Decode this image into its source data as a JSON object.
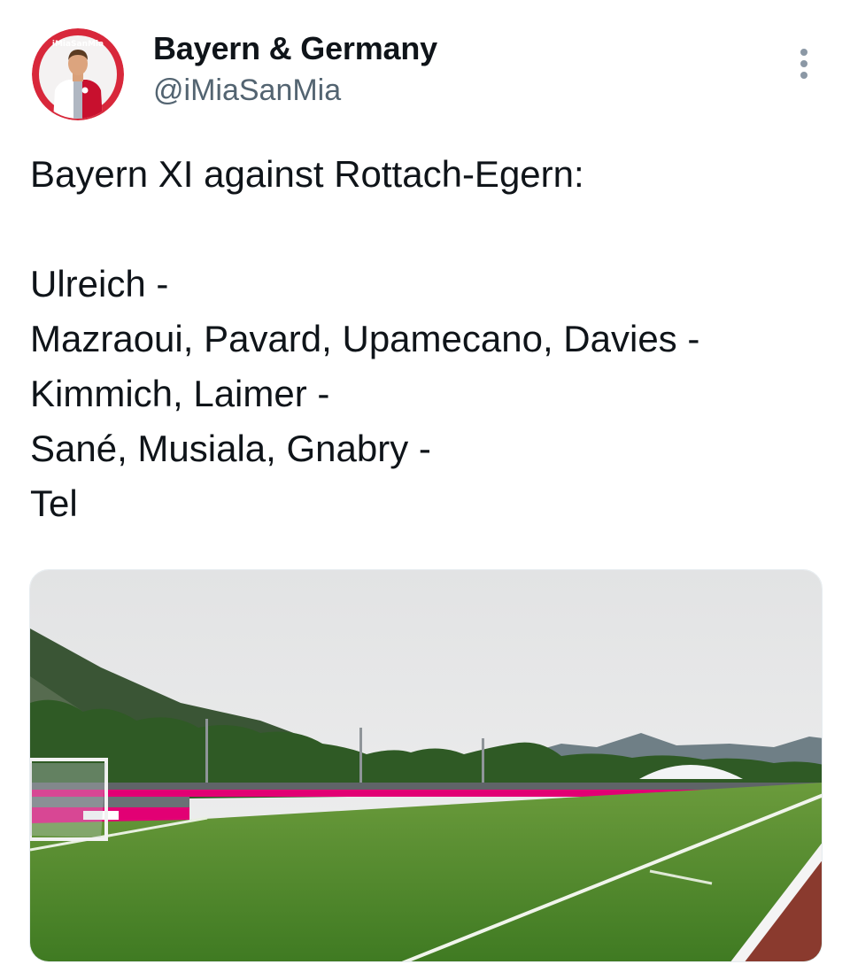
{
  "author": {
    "name": "Bayern & Germany",
    "handle": "@iMiaSanMia",
    "avatar_icon": "profile-avatar-player-in-bayern-kit",
    "avatar_ring_text": "iMiaSanMia"
  },
  "more_icon": "more-vertical-icon",
  "tweet": {
    "lines": [
      "Bayern XI against Rottach-Egern:",
      "",
      "Ulreich -",
      "Mazraoui, Pavard, Upamecano, Davies -",
      "Kimmich, Laimer -",
      "Sané, Musiala, Gnabry -",
      "Tel"
    ]
  },
  "media": {
    "description_icon": "football-pitch-photo",
    "colors": {
      "sky": "#e9eaeb",
      "grass": "#4f8a2a",
      "mountains": "#3e5a3a",
      "ad_boards": "#e20074"
    }
  },
  "colors": {
    "text_primary": "#0f1419",
    "text_secondary": "#536471",
    "bayern_red": "#dc052d"
  }
}
